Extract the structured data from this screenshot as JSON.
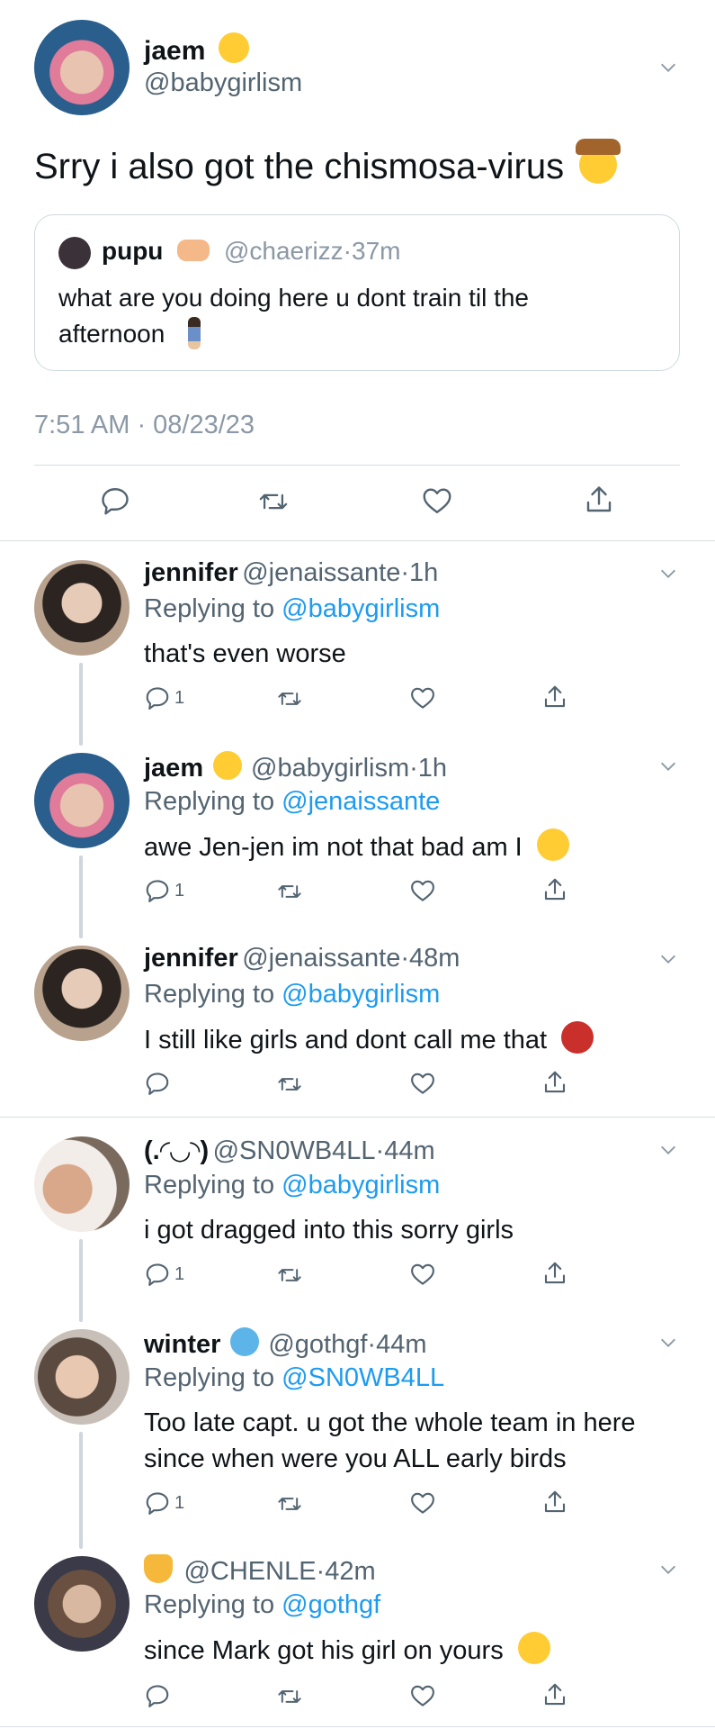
{
  "main_tweet": {
    "name": "jaem",
    "name_emoji": "kissing-face-emoji",
    "handle": "@babygirlism",
    "text": "Srry i also got the chismosa-virus",
    "text_emoji": "cowboy-face-emoji",
    "quote": {
      "name": "pupu",
      "name_emoji": "heart-hands-emoji",
      "handle": "@chaerizz",
      "time": "37m",
      "text_line1": "what are you doing here u dont train til the",
      "text_line2": "afternoon",
      "text_emoji": "standing-woman-emoji"
    },
    "timestamp": "7:51 AM · 08/23/23"
  },
  "replies": [
    {
      "name": "jennifer",
      "handle": "@jenaissante",
      "time": "1h",
      "replying_prefix": "Replying to",
      "replying_to": "@babygirlism",
      "text": "that's even worse",
      "reply_count": "1"
    },
    {
      "name": "jaem",
      "name_emoji": "kissing-face-emoji",
      "handle": "@babygirlism",
      "time": "1h",
      "replying_prefix": "Replying to",
      "replying_to": "@jenaissante",
      "text": "awe Jen-jen im not that bad am I",
      "text_emoji": "pleading-face-emoji",
      "reply_count": "1"
    },
    {
      "name": "jennifer",
      "handle": "@jenaissante",
      "time": "48m",
      "replying_prefix": "Replying to",
      "replying_to": "@babygirlism",
      "text": "I still like girls and dont call me that",
      "text_emoji": "ogre-emoji",
      "reply_count": ""
    },
    {
      "name": "(.◜◡◝)",
      "handle": "@SN0WB4LL",
      "time": "44m",
      "replying_prefix": "Replying to",
      "replying_to": "@babygirlism",
      "text": "i got dragged into this sorry girls",
      "reply_count": "1"
    },
    {
      "name": "winter",
      "name_emoji": "cold-face-emoji",
      "handle": "@gothgf",
      "time": "44m",
      "replying_prefix": "Replying to",
      "replying_to": "@SN0WB4LL",
      "text_line1": "Too late capt. u got the whole team in here",
      "text_line2": "since when were you ALL early birds",
      "reply_count": "1"
    },
    {
      "name_emoji": "smirking-cat-emoji",
      "handle": "@CHENLE",
      "time": "42m",
      "replying_prefix": "Replying to",
      "replying_to": "@gothgf",
      "text": "since Mark got his girl on yours",
      "text_emoji": "nerd-face-emoji",
      "reply_count": ""
    }
  ],
  "separator": "·",
  "colors": {
    "link": "#1d9bf0",
    "muted": "#536471",
    "divider": "#d8dde2"
  },
  "icons": [
    "reply-icon",
    "retweet-icon",
    "like-icon",
    "share-icon",
    "chevron-down-icon"
  ]
}
